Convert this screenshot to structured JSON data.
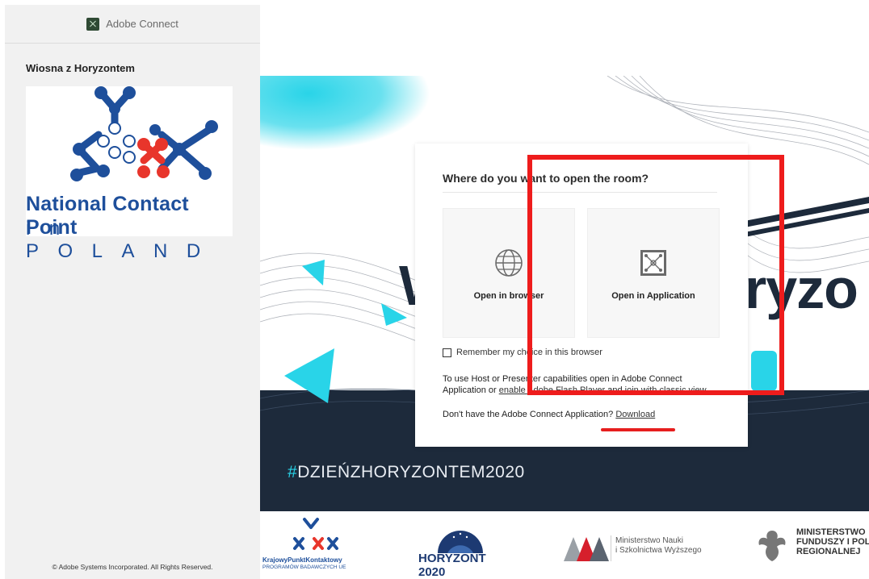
{
  "app": {
    "title": "Adobe Connect",
    "logo_icon": "adobe-connect-logo-icon"
  },
  "sidebar": {
    "room_name": "Wiosna z Horyzontem",
    "logo_line1": "National Contact Point",
    "logo_line2": "in POLAND",
    "copyright": "© Adobe Systems Incorporated. All Rights Reserved."
  },
  "banner": {
    "hashtag_prefix": "#",
    "hashtag_text": "DZIEŃZHORYZONTEM2020",
    "big_text_left": "W",
    "big_text_right": "ryzo"
  },
  "dialog": {
    "title": "Where do you want to open the room?",
    "option_browser": {
      "label": "Open in browser",
      "icon": "globe-icon"
    },
    "option_app": {
      "label": "Open in Application",
      "icon": "adobe-connect-app-icon"
    },
    "remember_label": "Remember my choice in this browser",
    "remember_checked": false,
    "info_text_1": "To use Host or Presenter capabilities open in Adobe Connect Application or ",
    "info_link_flash": "enable Adobe Flash Player",
    "info_text_2": " and ",
    "info_link_classic": "join with classic view.",
    "download_prompt": "Don't have the Adobe Connect Application? ",
    "download_link": "Download"
  },
  "footer": {
    "kpk_line1": "KrajowyPunktKontaktowy",
    "kpk_line2": "PROGRAMÓW BADAWCZYCH UE",
    "horyzont": "HORYZONT 2020",
    "ministry_line1": "Ministerstwo Nauki",
    "ministry_line2": "i Szkolnictwa Wyższego",
    "mfr_line1": "MINISTERSTWO",
    "mfr_line2": "FUNDUSZY I POL",
    "mfr_line3": "REGIONALNEJ"
  },
  "colors": {
    "accent_cyan": "#29d4e8",
    "dark_navy": "#1d2a3b",
    "annotation_red": "#ee1c1c",
    "ncp_blue": "#1e4f9b",
    "ncp_red": "#e8352b"
  }
}
